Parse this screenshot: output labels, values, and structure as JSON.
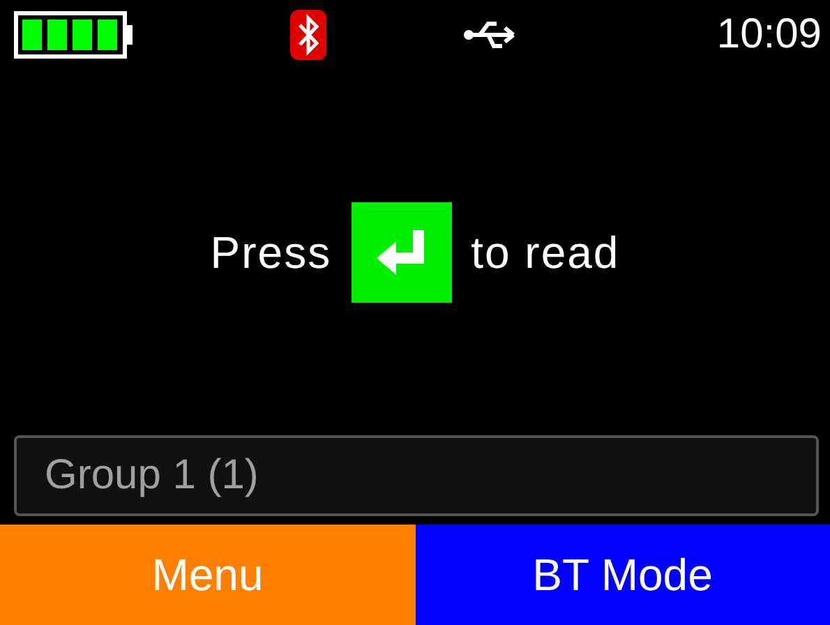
{
  "status_bar": {
    "time": "10:09"
  },
  "prompt": {
    "before": "Press",
    "after": "to read"
  },
  "group_field": {
    "value": "Group 1 (1)"
  },
  "softkeys": [
    {
      "label": "Menu",
      "color": "#ff8000"
    },
    {
      "label": "BT Mode",
      "color": "#0000ff"
    }
  ]
}
